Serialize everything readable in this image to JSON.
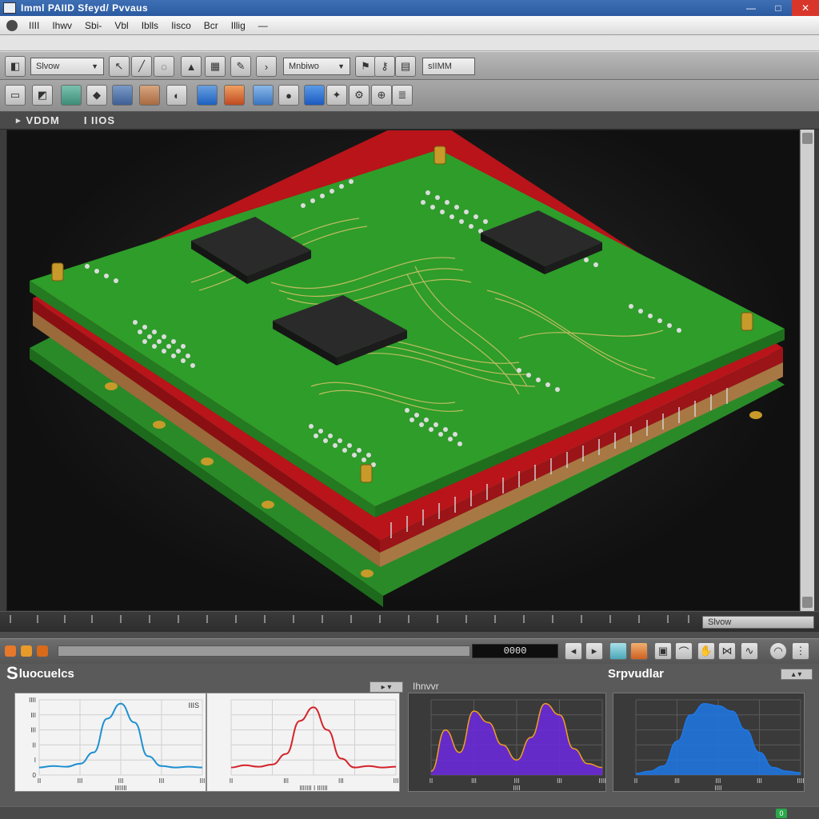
{
  "window": {
    "title": "Imml PAIID Sfeyd/  Pvvaus",
    "controls": [
      "—",
      "□",
      "✕"
    ]
  },
  "menu": {
    "items": [
      "IIII",
      "Ihwv",
      "Sbi-",
      "Vbl",
      "Iblls",
      "Iisco",
      "Bcr",
      "Illig",
      "—"
    ]
  },
  "toolbar": {
    "view_select": "Slvow",
    "mode_select": "Mnbiwo",
    "layer_select": "sIIMM",
    "icons": [
      "camera-icon",
      "cursor-icon",
      "line-icon",
      "lens-icon",
      "hat-icon",
      "grid-icon",
      "pen-icon",
      "chevron-icon",
      "tag-icon",
      "key-icon",
      "chart-icon"
    ],
    "icons_row2": [
      "monitor-icon",
      "eraser-icon",
      "prism-icon",
      "shape-icon",
      "box-icon",
      "cube-icon",
      "rotate-icon",
      "mountain-icon",
      "fill-icon",
      "shield-icon",
      "sphere-icon",
      "leaf-icon",
      "bird-icon",
      "gear-icon",
      "pin-icon",
      "layers-icon"
    ]
  },
  "viewport": {
    "label": "VDDM",
    "value": "I IIOS",
    "object": "stacked-pcb-3d-model"
  },
  "ruler": {
    "zoom_field": "Slvow"
  },
  "timeline": {
    "counter": "0000"
  },
  "panels": {
    "left_title_first": "S",
    "left_title_rest": "luocuelcs",
    "right_title": "Srpvudlar",
    "mid_title": "Ihnvvr",
    "charts": [
      {
        "id": "chart-1",
        "corner_label": "IIIS",
        "y_ticks": [
          "IIII",
          "III",
          "III",
          "II",
          "I",
          "0"
        ],
        "x_ticks": [
          "II",
          "III",
          "III",
          "III",
          "III"
        ],
        "x_title": "IIIIIII"
      },
      {
        "id": "chart-2",
        "x_ticks": [
          "II",
          "III",
          "III",
          "III"
        ],
        "x_title": "IIIIIII I IIIIII"
      },
      {
        "id": "chart-3",
        "x_ticks": [
          "II",
          "III",
          "III",
          "III",
          "IIII"
        ],
        "x_title": "IIII"
      },
      {
        "id": "chart-4",
        "x_ticks": [
          "II",
          "III",
          "III",
          "III",
          "IIII"
        ],
        "x_title": "IIII"
      }
    ]
  },
  "colors": {
    "chart1_line": "#1f8fd1",
    "chart2_line": "#d4232a",
    "chart4_fill": "#1e78e6",
    "pcb_green": "#2e9d2a"
  },
  "chart_data": [
    {
      "type": "line",
      "series": [
        {
          "values": [
            0.1,
            0.12,
            0.11,
            0.15,
            0.3,
            0.75,
            0.95,
            0.7,
            0.25,
            0.12,
            0.1,
            0.11,
            0.1
          ]
        }
      ]
    },
    {
      "type": "line",
      "series": [
        {
          "values": [
            0.1,
            0.13,
            0.11,
            0.14,
            0.28,
            0.72,
            0.9,
            0.6,
            0.22,
            0.1,
            0.12,
            0.1,
            0.11
          ]
        }
      ]
    },
    {
      "type": "area",
      "series": [
        {
          "values": [
            0.05,
            0.6,
            0.3,
            0.85,
            0.7,
            0.4,
            0.2,
            0.5,
            0.95,
            0.8,
            0.35,
            0.15,
            0.1
          ]
        }
      ]
    },
    {
      "type": "area",
      "series": [
        {
          "values": [
            0.02,
            0.05,
            0.12,
            0.45,
            0.8,
            0.95,
            0.92,
            0.85,
            0.6,
            0.3,
            0.1,
            0.05,
            0.03
          ]
        }
      ]
    }
  ]
}
